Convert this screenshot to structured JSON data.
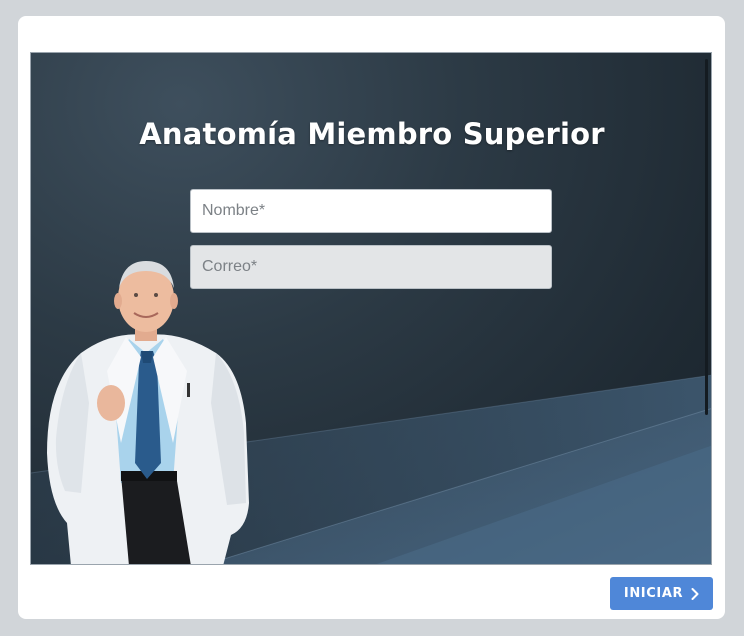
{
  "page": {
    "title": "Anatomía Miembro Superior"
  },
  "form": {
    "name_placeholder": "Nombre*",
    "name_value": "",
    "email_placeholder": "Correo*",
    "email_value": ""
  },
  "footer": {
    "start_label": "INICIAR"
  },
  "icons": {
    "start_icon": "chevron-right-icon"
  },
  "colors": {
    "button_bg": "#4f87d8",
    "stage_bg_dark": "#1f2a33",
    "stage_bg_light": "#3e4f5d"
  }
}
